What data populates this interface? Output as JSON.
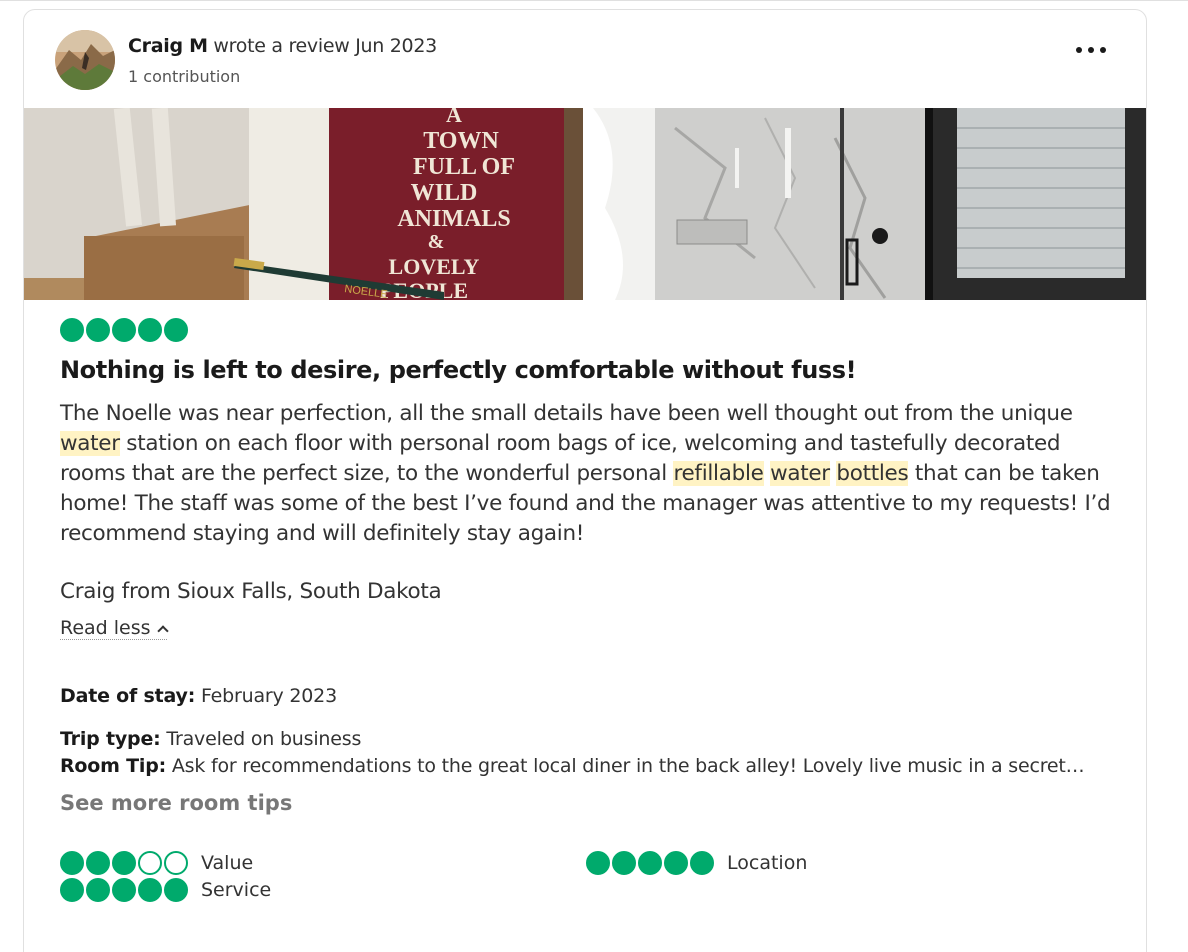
{
  "review": {
    "author": "Craig M",
    "action": "wrote a review Jun 2023",
    "contributions": "1 contribution",
    "rating": 5,
    "title": "Nothing is left to desire, perfectly comfortable without fuss!",
    "text_parts": {
      "p1": "The Noelle was near perfection, all the small details have been well thought out from the unique ",
      "hl1": "water",
      "p2": " station on each floor with personal room bags of ice, welcoming and tastefully decorated rooms that are the perfect size, to the wonderful personal ",
      "hl2": "refillable",
      "hl3": "water",
      "hl4": "bottles",
      "p3": " that can be taken home! The staff was some of the best I’ve found and the manager was attentive to my requests! I’d recommend staying and will definitely stay again!"
    },
    "signature": "Craig from Sioux Falls, South Dakota",
    "read_less": "Read less",
    "date_of_stay_label": "Date of stay:",
    "date_of_stay": "February 2023",
    "trip_type_label": "Trip type:",
    "trip_type": "Traveled on business",
    "room_tip_label": "Room Tip:",
    "room_tip": "Ask for recommendations to the great local diner in the back alley! Lovely live music in a secret…",
    "see_more_tips": "See more room tips",
    "photo1_text": {
      "line1": "A",
      "line2": "TOWN",
      "line3": "FULL OF",
      "line4": "WILD",
      "line5": "ANIMALS",
      "line6": "&",
      "line7": "LOVELY",
      "line8": "PEOPLE",
      "pen": "NOELLE"
    },
    "sub_ratings": [
      {
        "label": "Value",
        "score": 3
      },
      {
        "label": "Location",
        "score": 5
      },
      {
        "label": "Service",
        "score": 5
      }
    ]
  },
  "colors": {
    "bubble": "#00aa6c",
    "highlight": "#fff3c4",
    "book": "#7a1e2a"
  },
  "icons": {
    "more": "more-horizontal-icon",
    "chevron": "chevron-up-icon",
    "bubble": "rating-bubble-icon"
  }
}
